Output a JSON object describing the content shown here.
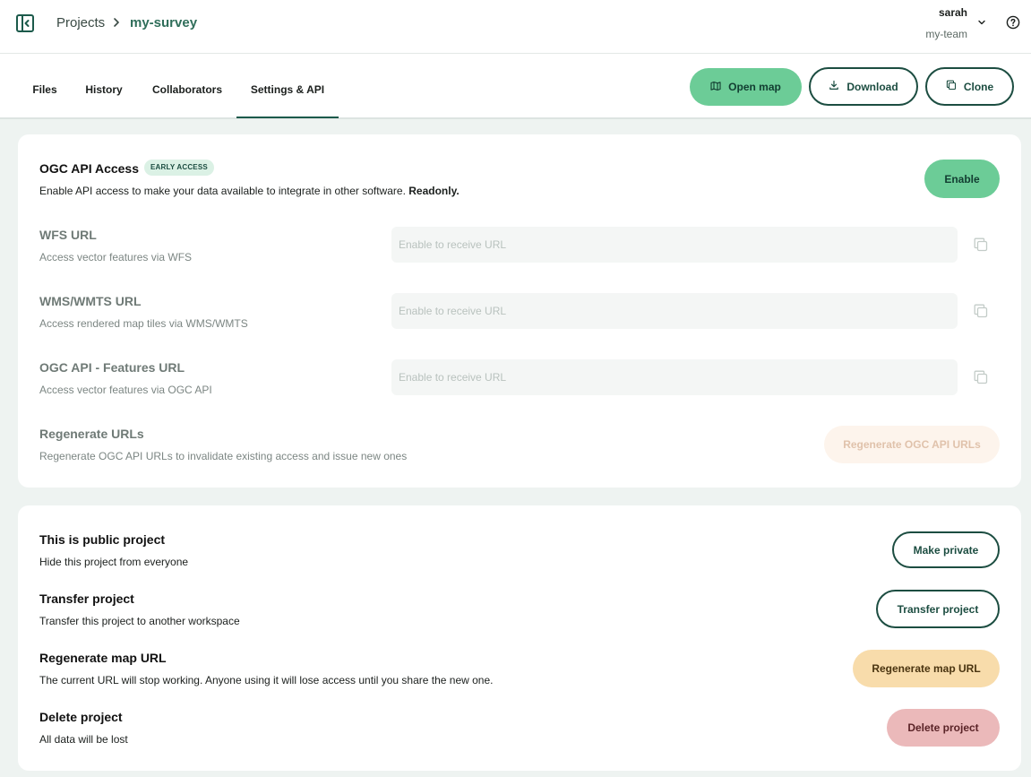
{
  "topbar": {
    "breadcrumb": {
      "projects": "Projects",
      "current": "my-survey"
    },
    "user": {
      "name": "sarah",
      "team": "my-team"
    }
  },
  "tabs": [
    {
      "label": "Files",
      "active": false
    },
    {
      "label": "History",
      "active": false
    },
    {
      "label": "Collaborators",
      "active": false
    },
    {
      "label": "Settings & API",
      "active": true
    }
  ],
  "actions": {
    "open_map": "Open map",
    "download": "Download",
    "clone": "Clone"
  },
  "ogc": {
    "title": "OGC API Access",
    "badge": "EARLY ACCESS",
    "description": "Enable API access to make your data available to integrate in other software.",
    "description_bold": "Readonly.",
    "enable_label": "Enable",
    "rows": [
      {
        "label": "WFS URL",
        "description": "Access vector features via WFS",
        "placeholder": "Enable to receive URL"
      },
      {
        "label": "WMS/WMTS URL",
        "description": "Access rendered map tiles via WMS/WMTS",
        "placeholder": "Enable to receive URL"
      },
      {
        "label": "OGC API - Features URL",
        "description": "Access vector features via OGC API",
        "placeholder": "Enable to receive URL"
      }
    ],
    "regenerate": {
      "label": "Regenerate URLs",
      "description": "Regenerate OGC API URLs to invalidate existing access and issue new ones",
      "button": "Regenerate OGC API URLs"
    }
  },
  "project_settings": [
    {
      "title": "This is public project",
      "description": "Hide this project from everyone",
      "button": "Make private"
    },
    {
      "title": "Transfer project",
      "description": "Transfer this project to another workspace",
      "button": "Transfer project"
    },
    {
      "title": "Regenerate map URL",
      "description": "The current URL will stop working. Anyone using it will lose access until you share the new one.",
      "button": "Regenerate map URL"
    },
    {
      "title": "Delete project",
      "description": "All data will be lost",
      "button": "Delete project"
    }
  ],
  "colors": {
    "accent_green": "#6ccc97",
    "dark_green": "#1c4d41",
    "warning": "#f8dcab",
    "danger": "#ebb9ba",
    "background": "#eef3f1"
  },
  "icons": {
    "sidebar_toggle": "sidebar-collapse-icon",
    "breadcrumb_separator": "chevron-right-icon",
    "user_menu": "chevron-down-icon",
    "help": "help-circle-icon",
    "open_map": "map-icon",
    "download": "download-icon",
    "clone": "copy-icon",
    "copy_url": "copy-icon"
  }
}
